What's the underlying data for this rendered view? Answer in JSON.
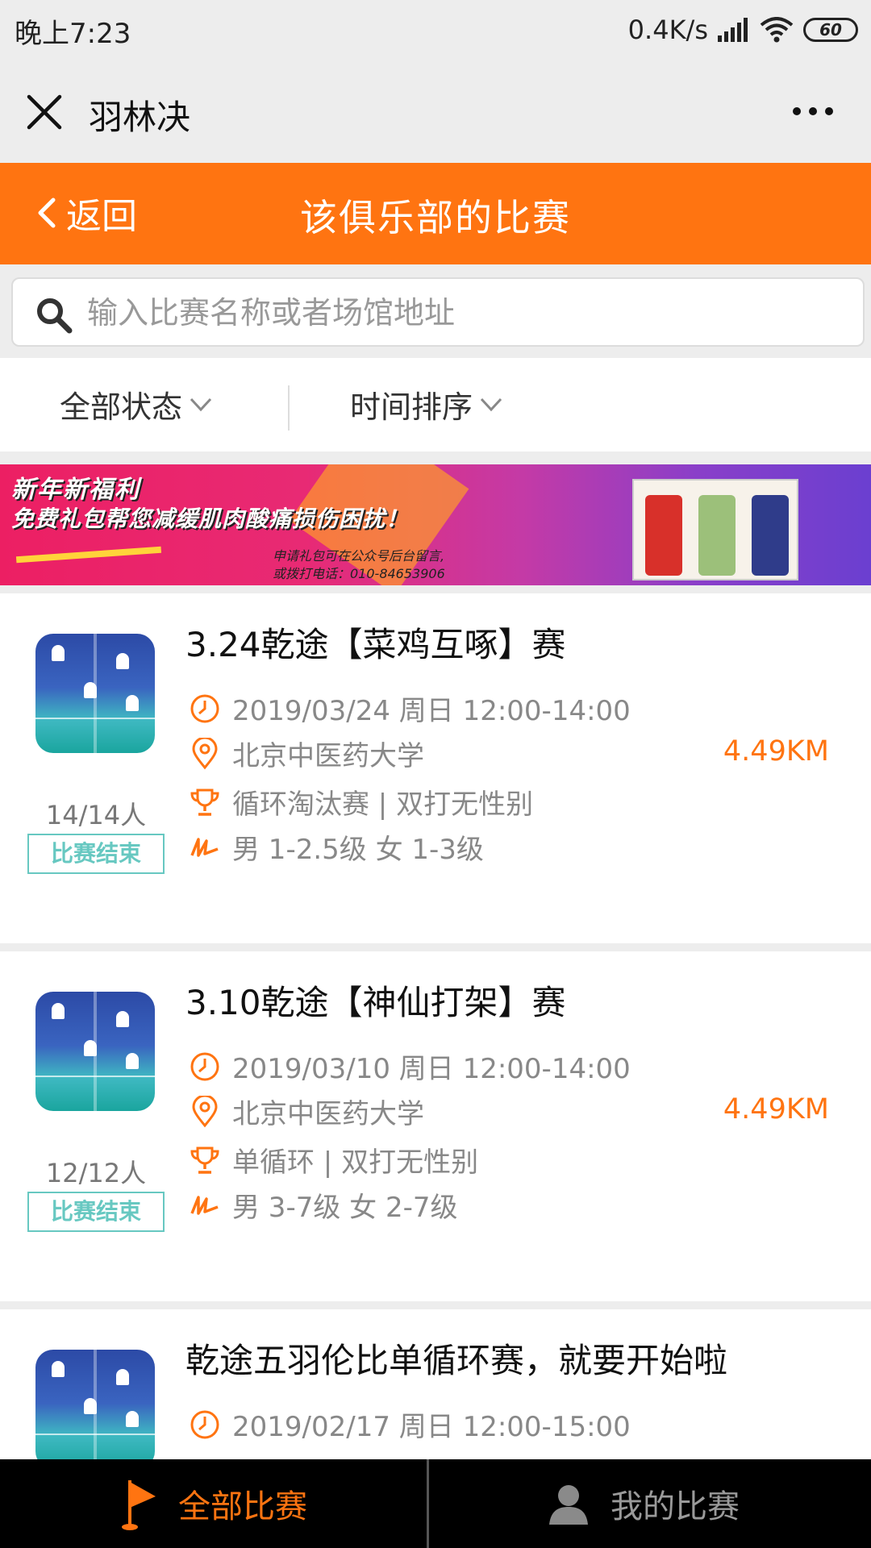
{
  "status_bar": {
    "time": "晚上7:23",
    "net_speed": "0.4K/s",
    "battery": "60",
    "icons": [
      "signal-icon",
      "wifi-icon",
      "battery-icon"
    ]
  },
  "title_bar": {
    "title": "羽林决",
    "icons": [
      "close-icon",
      "more-icon"
    ]
  },
  "header": {
    "back_label": "返回",
    "title": "该俱乐部的比赛",
    "color": "#ff7411"
  },
  "search": {
    "placeholder": "输入比赛名称或者场馆地址",
    "value": ""
  },
  "filters": {
    "status_label": "全部状态",
    "sort_label": "时间排序"
  },
  "banner": {
    "line1": "新年新福利",
    "line2": "免费礼包帮您减缓肌肉酸痛损伤困扰！",
    "line3": "申请礼包可在公众号后台留言,",
    "line4": "或拨打电话：010-84653906"
  },
  "matches": [
    {
      "name": "3.24乾途【菜鸡互啄】赛",
      "datetime": "2019/03/24 周日 12:00-14:00",
      "venue": "北京中医药大学",
      "distance": "4.49KM",
      "format": "循环淘汰赛 | 双打无性别",
      "level": "男 1-2.5级 女 1-3级",
      "count": "14/14人",
      "status": "比赛结束"
    },
    {
      "name": "3.10乾途【神仙打架】赛",
      "datetime": "2019/03/10 周日 12:00-14:00",
      "venue": "北京中医药大学",
      "distance": "4.49KM",
      "format": "单循环 | 双打无性别",
      "level": "男 3-7级 女 2-7级",
      "count": "12/12人",
      "status": "比赛结束"
    },
    {
      "name": "乾途五羽伦比单循环赛，就要开始啦",
      "datetime": "2019/02/17 周日 12:00-15:00"
    }
  ],
  "tabbar": {
    "tab_all": "全部比赛",
    "tab_mine": "我的比赛",
    "active_color": "#ff7411",
    "inactive_color": "#9a9a9a"
  }
}
